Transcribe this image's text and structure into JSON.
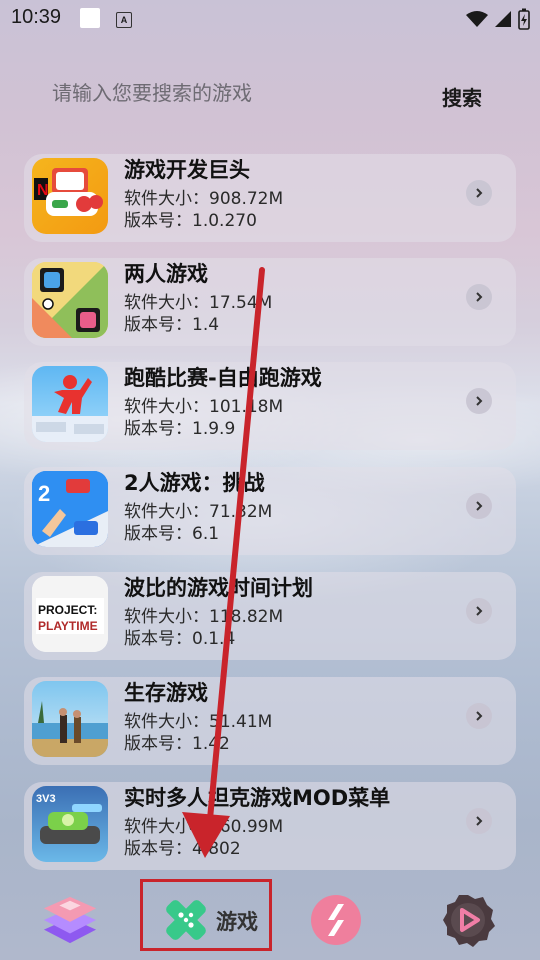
{
  "status_bar": {
    "time": "10:39",
    "a_icon_letter": "A"
  },
  "search": {
    "placeholder": "请输入您要搜索的游戏",
    "button_label": "搜索"
  },
  "games": [
    {
      "title": "游戏开发巨头",
      "size": "软件大小：908.72M",
      "version": "版本号：1.0.270",
      "icon": "game-dev-tycoon-icon"
    },
    {
      "title": "两人游戏",
      "size": "软件大小：17.54M",
      "version": "版本号：1.4",
      "icon": "two-player-game-icon"
    },
    {
      "title": "跑酷比赛-自由跑游戏",
      "size": "软件大小：101.18M",
      "version": "版本号：1.9.9",
      "icon": "parkour-race-icon"
    },
    {
      "title": "2人游戏：挑战",
      "size": "软件大小：71.32M",
      "version": "版本号：6.1",
      "icon": "two-player-challenge-icon"
    },
    {
      "title": "波比的游戏时间计划",
      "size": "软件大小：118.82M",
      "version": "版本号：0.1.4",
      "icon": "project-playtime-icon",
      "icon_text": "PROJECT: PLAYTIME"
    },
    {
      "title": "生存游戏",
      "size": "软件大小：51.41M",
      "version": "版本号：1.42",
      "icon": "survival-game-icon"
    },
    {
      "title": "实时多人坦克游戏MOD菜单",
      "size": "软件大小：160.99M",
      "version": "版本号：4.802",
      "icon": "tank-game-icon",
      "icon_text": "3V3"
    }
  ],
  "bottom_nav": {
    "items": [
      {
        "name": "layers-icon"
      },
      {
        "name": "game-tab-icon",
        "label": "游戏"
      },
      {
        "name": "pink-circle-icon"
      },
      {
        "name": "play-gear-icon"
      }
    ]
  },
  "colors": {
    "highlight": "#c9242b",
    "game_tab_green": "#38c98a",
    "pink": "#ef7f9d",
    "purple": "#8a5cf0"
  }
}
